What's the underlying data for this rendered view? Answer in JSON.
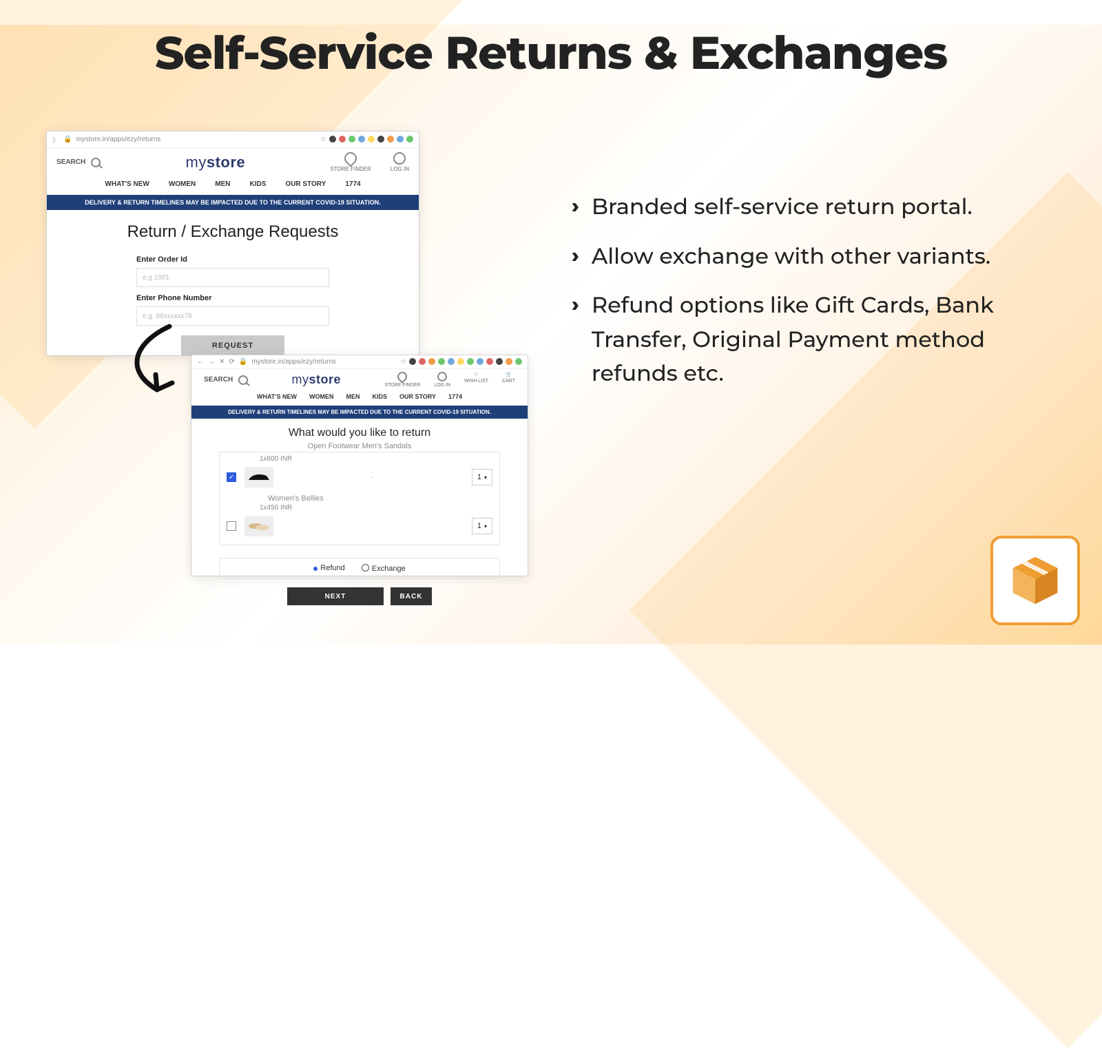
{
  "title": "Self-Service Returns & Exchanges",
  "bullets": [
    "Branded self-service return portal.",
    "Allow exchange with other variants.",
    "Refund options like Gift Cards, Bank Transfer, Original Payment method refunds etc."
  ],
  "shot1": {
    "url": "mystore.in/apps/ezy/returns",
    "search_label": "SEARCH",
    "logo_a": "my",
    "logo_b": "store",
    "action_store": "STORE FINDER",
    "action_login": "LOG IN",
    "menu": [
      "WHAT'S NEW",
      "WOMEN",
      "MEN",
      "KIDS",
      "OUR STORY",
      "1774"
    ],
    "banner": "DELIVERY & RETURN TIMELINES MAY BE IMPACTED DUE TO THE CURRENT COVID-19 SITUATION.",
    "heading": "Return / Exchange Requests",
    "label_order": "Enter Order Id",
    "ph_order": "e.g 1001",
    "label_phone": "Enter Phone Number",
    "ph_phone": "e.g. 88xxxxxx78",
    "button": "REQUEST"
  },
  "shot2": {
    "url": "mystore.in/apps/ezy/returns",
    "search_label": "SEARCH",
    "logo_a": "my",
    "logo_b": "store",
    "actions": [
      "STORE FINDER",
      "LOG IN",
      "WISH LIST",
      "CART"
    ],
    "menu": [
      "WHAT'S NEW",
      "WOMEN",
      "MEN",
      "KIDS",
      "OUR STORY",
      "1774"
    ],
    "banner": "DELIVERY & RETURN TIMELINES MAY BE IMPACTED DUE TO THE CURRENT COVID-19 SITUATION.",
    "heading": "What would you like to return",
    "items": [
      {
        "name": "Open Footwear Men's Sandals",
        "price": "1x800 INR",
        "checked": true,
        "qty": "1"
      },
      {
        "name": "Women's Bellies",
        "price": "1x450 INR",
        "checked": false,
        "qty": "1"
      }
    ],
    "opt_refund": "Refund",
    "opt_exchange": "Exchange",
    "btn_next": "NEXT",
    "btn_back": "BACK"
  }
}
